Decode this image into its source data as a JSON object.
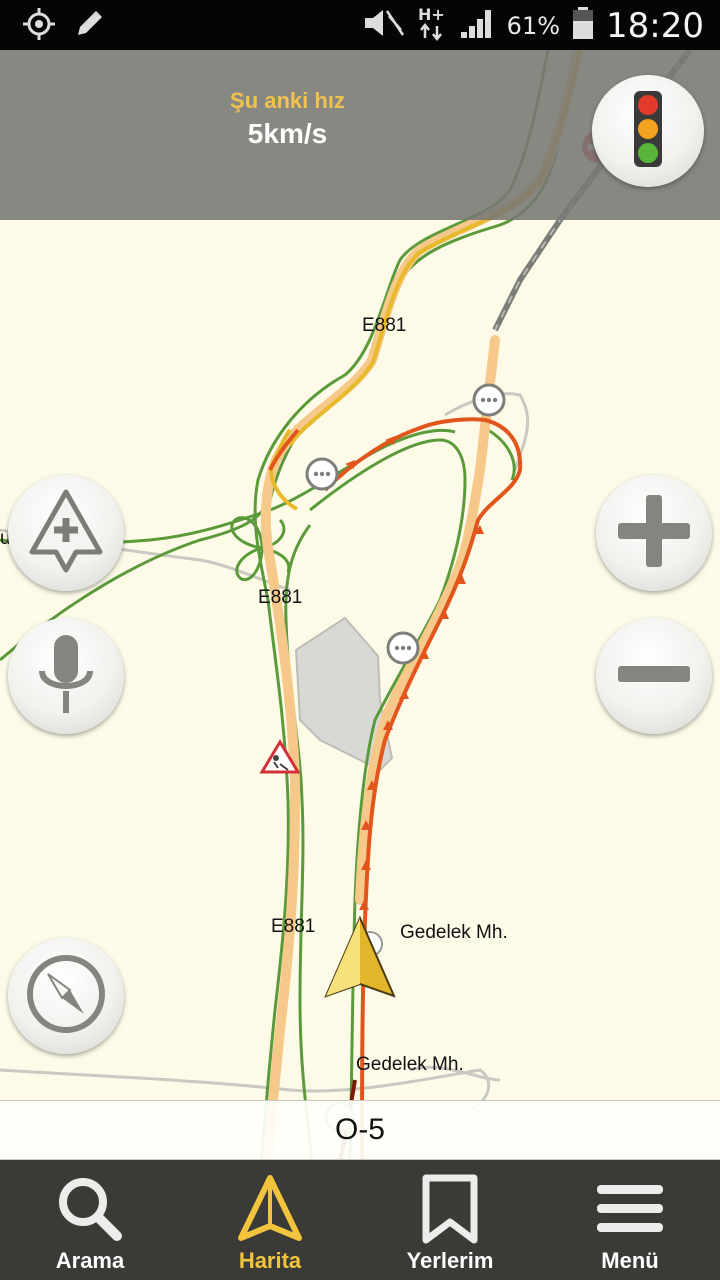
{
  "status_bar": {
    "battery_percent": "61%",
    "time": "18:20",
    "icons": [
      "location-icon",
      "edit-icon",
      "mute-icon",
      "network-hplus-icon",
      "signal-icon",
      "battery-icon"
    ]
  },
  "speed_panel": {
    "title": "Şu anki hız",
    "value": "5km/s"
  },
  "map": {
    "labels": {
      "road_e881_top": "E881",
      "road_e881_mid": "E881",
      "road_e881_bottom": "E881",
      "place_gedelek_1": "Gedelek Mh.",
      "place_gedelek_2": "Gedelek Mh.",
      "edge_fragment": "u"
    },
    "colors": {
      "traffic_red": "#e2561d",
      "traffic_yellow": "#e8b92a",
      "traffic_green": "#5a9a3a",
      "road_fill": "#f6c98a",
      "background": "#fdfbe8"
    },
    "buttons": {
      "traffic": "traffic-light-icon",
      "add_event": "add-road-event-icon",
      "voice": "microphone-icon",
      "zoom_in": "plus-icon",
      "zoom_out": "minus-icon",
      "compass": "compass-icon"
    }
  },
  "route_bar": {
    "road_name": "O-5"
  },
  "bottom_nav": {
    "items": [
      {
        "label": "Arama",
        "icon": "search-icon",
        "active": false
      },
      {
        "label": "Harita",
        "icon": "map-arrow-icon",
        "active": true
      },
      {
        "label": "Yerlerim",
        "icon": "bookmark-icon",
        "active": false
      },
      {
        "label": "Menü",
        "icon": "menu-icon",
        "active": false
      }
    ]
  }
}
